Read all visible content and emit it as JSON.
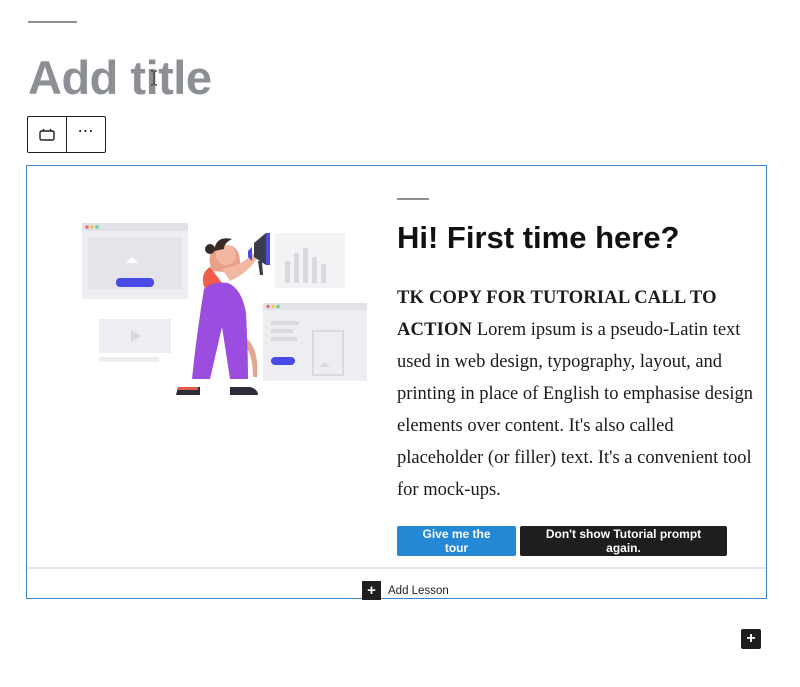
{
  "editor": {
    "title_placeholder": "Add title",
    "toolbar": {
      "more_glyph": "⋯"
    }
  },
  "tutorial": {
    "heading": "Hi! First time here?",
    "body_strong": "TK COPY FOR TUTORIAL CALL TO ACTION",
    "body_text": " Lorem ipsum is a pseudo-Latin text used in web design, typography, layout, and printing in place of English to emphasise design elements over content. It's also called placeholder (or filler) text. It's a convenient tool for mock-ups.",
    "primary_button": "Give me the tour",
    "secondary_button": "Don't show Tutorial prompt again.",
    "colors": {
      "primary_button": "#2588d4",
      "dark_button": "#1e1e1e",
      "block_border": "#3a86c8",
      "title": "#8c8f94"
    }
  },
  "lesson": {
    "plus_glyph": "+",
    "label": "Add Lesson"
  },
  "inserter": {
    "plus_glyph": "+"
  },
  "icons": [
    "block-type-icon",
    "more-options-icon",
    "plus-icon",
    "text-cursor-icon"
  ]
}
